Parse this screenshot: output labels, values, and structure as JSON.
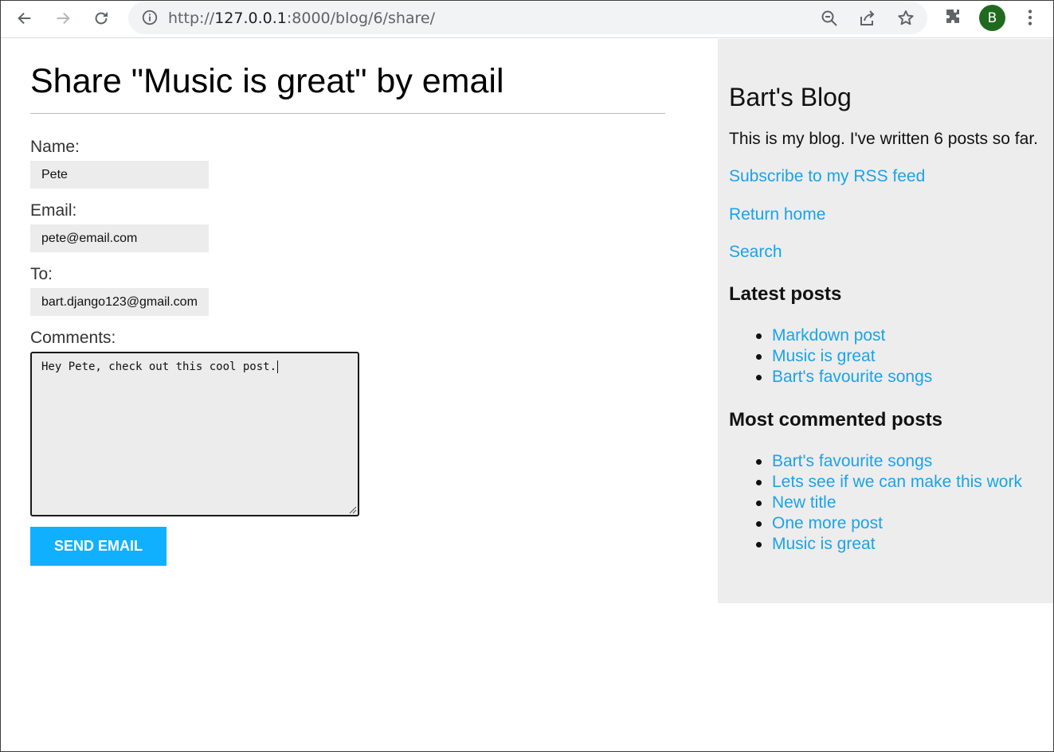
{
  "browser": {
    "url_scheme": "http://",
    "url_host": "127.0.0.1",
    "url_rest": ":8000/blog/6/share/",
    "profile_initial": "B"
  },
  "page": {
    "title": "Share \"Music is great\" by email"
  },
  "form": {
    "name_label": "Name:",
    "name_value": "Pete",
    "email_label": "Email:",
    "email_value": "pete@email.com",
    "to_label": "To:",
    "to_value": "bart.django123@gmail.com",
    "comments_label": "Comments:",
    "comments_value": "Hey Pete, check out this cool post.",
    "submit_label": "Send email"
  },
  "sidebar": {
    "title": "Bart's Blog",
    "description": "This is my blog. I've written 6 posts so far.",
    "links": [
      "Subscribe to my RSS feed",
      "Return home",
      "Search"
    ],
    "latest_heading": "Latest posts",
    "latest_posts": [
      "Markdown post",
      "Music is great",
      "Bart's favourite songs"
    ],
    "most_commented_heading": "Most commented posts",
    "most_commented_posts": [
      "Bart's favourite songs",
      "Lets see if we can make this work",
      "New title",
      "One more post",
      "Music is great"
    ]
  },
  "colors": {
    "link": "#1aa3e8",
    "button": "#10b0ff",
    "sidebar_bg": "#ededed",
    "input_bg": "#ececec",
    "avatar": "#1f6a1f"
  }
}
